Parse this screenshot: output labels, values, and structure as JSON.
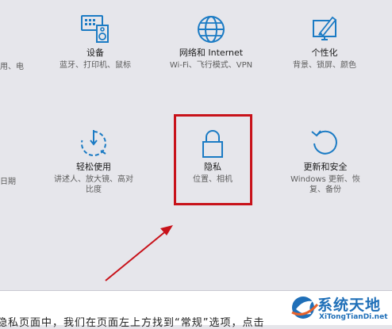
{
  "tiles": {
    "devices": {
      "title": "设备",
      "desc": "蓝牙、打印机、鼠标",
      "icon": "keyboard-speaker-icon"
    },
    "network": {
      "title": "网络和 Internet",
      "desc": "Wi-Fi、飞行模式、VPN",
      "icon": "globe-icon"
    },
    "personalization": {
      "title": "个性化",
      "desc": "背景、锁屏、颜色",
      "icon": "paint-screen-icon"
    },
    "ease": {
      "title": "轻松使用",
      "desc_line1": "讲述人、放大镜、高对",
      "desc_line2": "比度",
      "icon": "ease-of-access-timer-icon"
    },
    "privacy": {
      "title": "隐私",
      "desc": "位置、相机",
      "icon": "lock-icon"
    },
    "update": {
      "title": "更新和安全",
      "desc_line1": "Windows 更新、恢",
      "desc_line2": "复、备份",
      "icon": "refresh-arrow-icon"
    }
  },
  "edge_left": {
    "top_text": "用、电",
    "mid_text": "日期"
  },
  "bottom_text": "隐私页面中，我们在页面左上方找到“常规”选项，点击",
  "watermark": {
    "name": "系统天地",
    "url": "XiTongTianDi.net"
  },
  "colors": {
    "accent": "#1b7bc4",
    "highlight": "#c8121a",
    "arrow": "#c8121a"
  }
}
